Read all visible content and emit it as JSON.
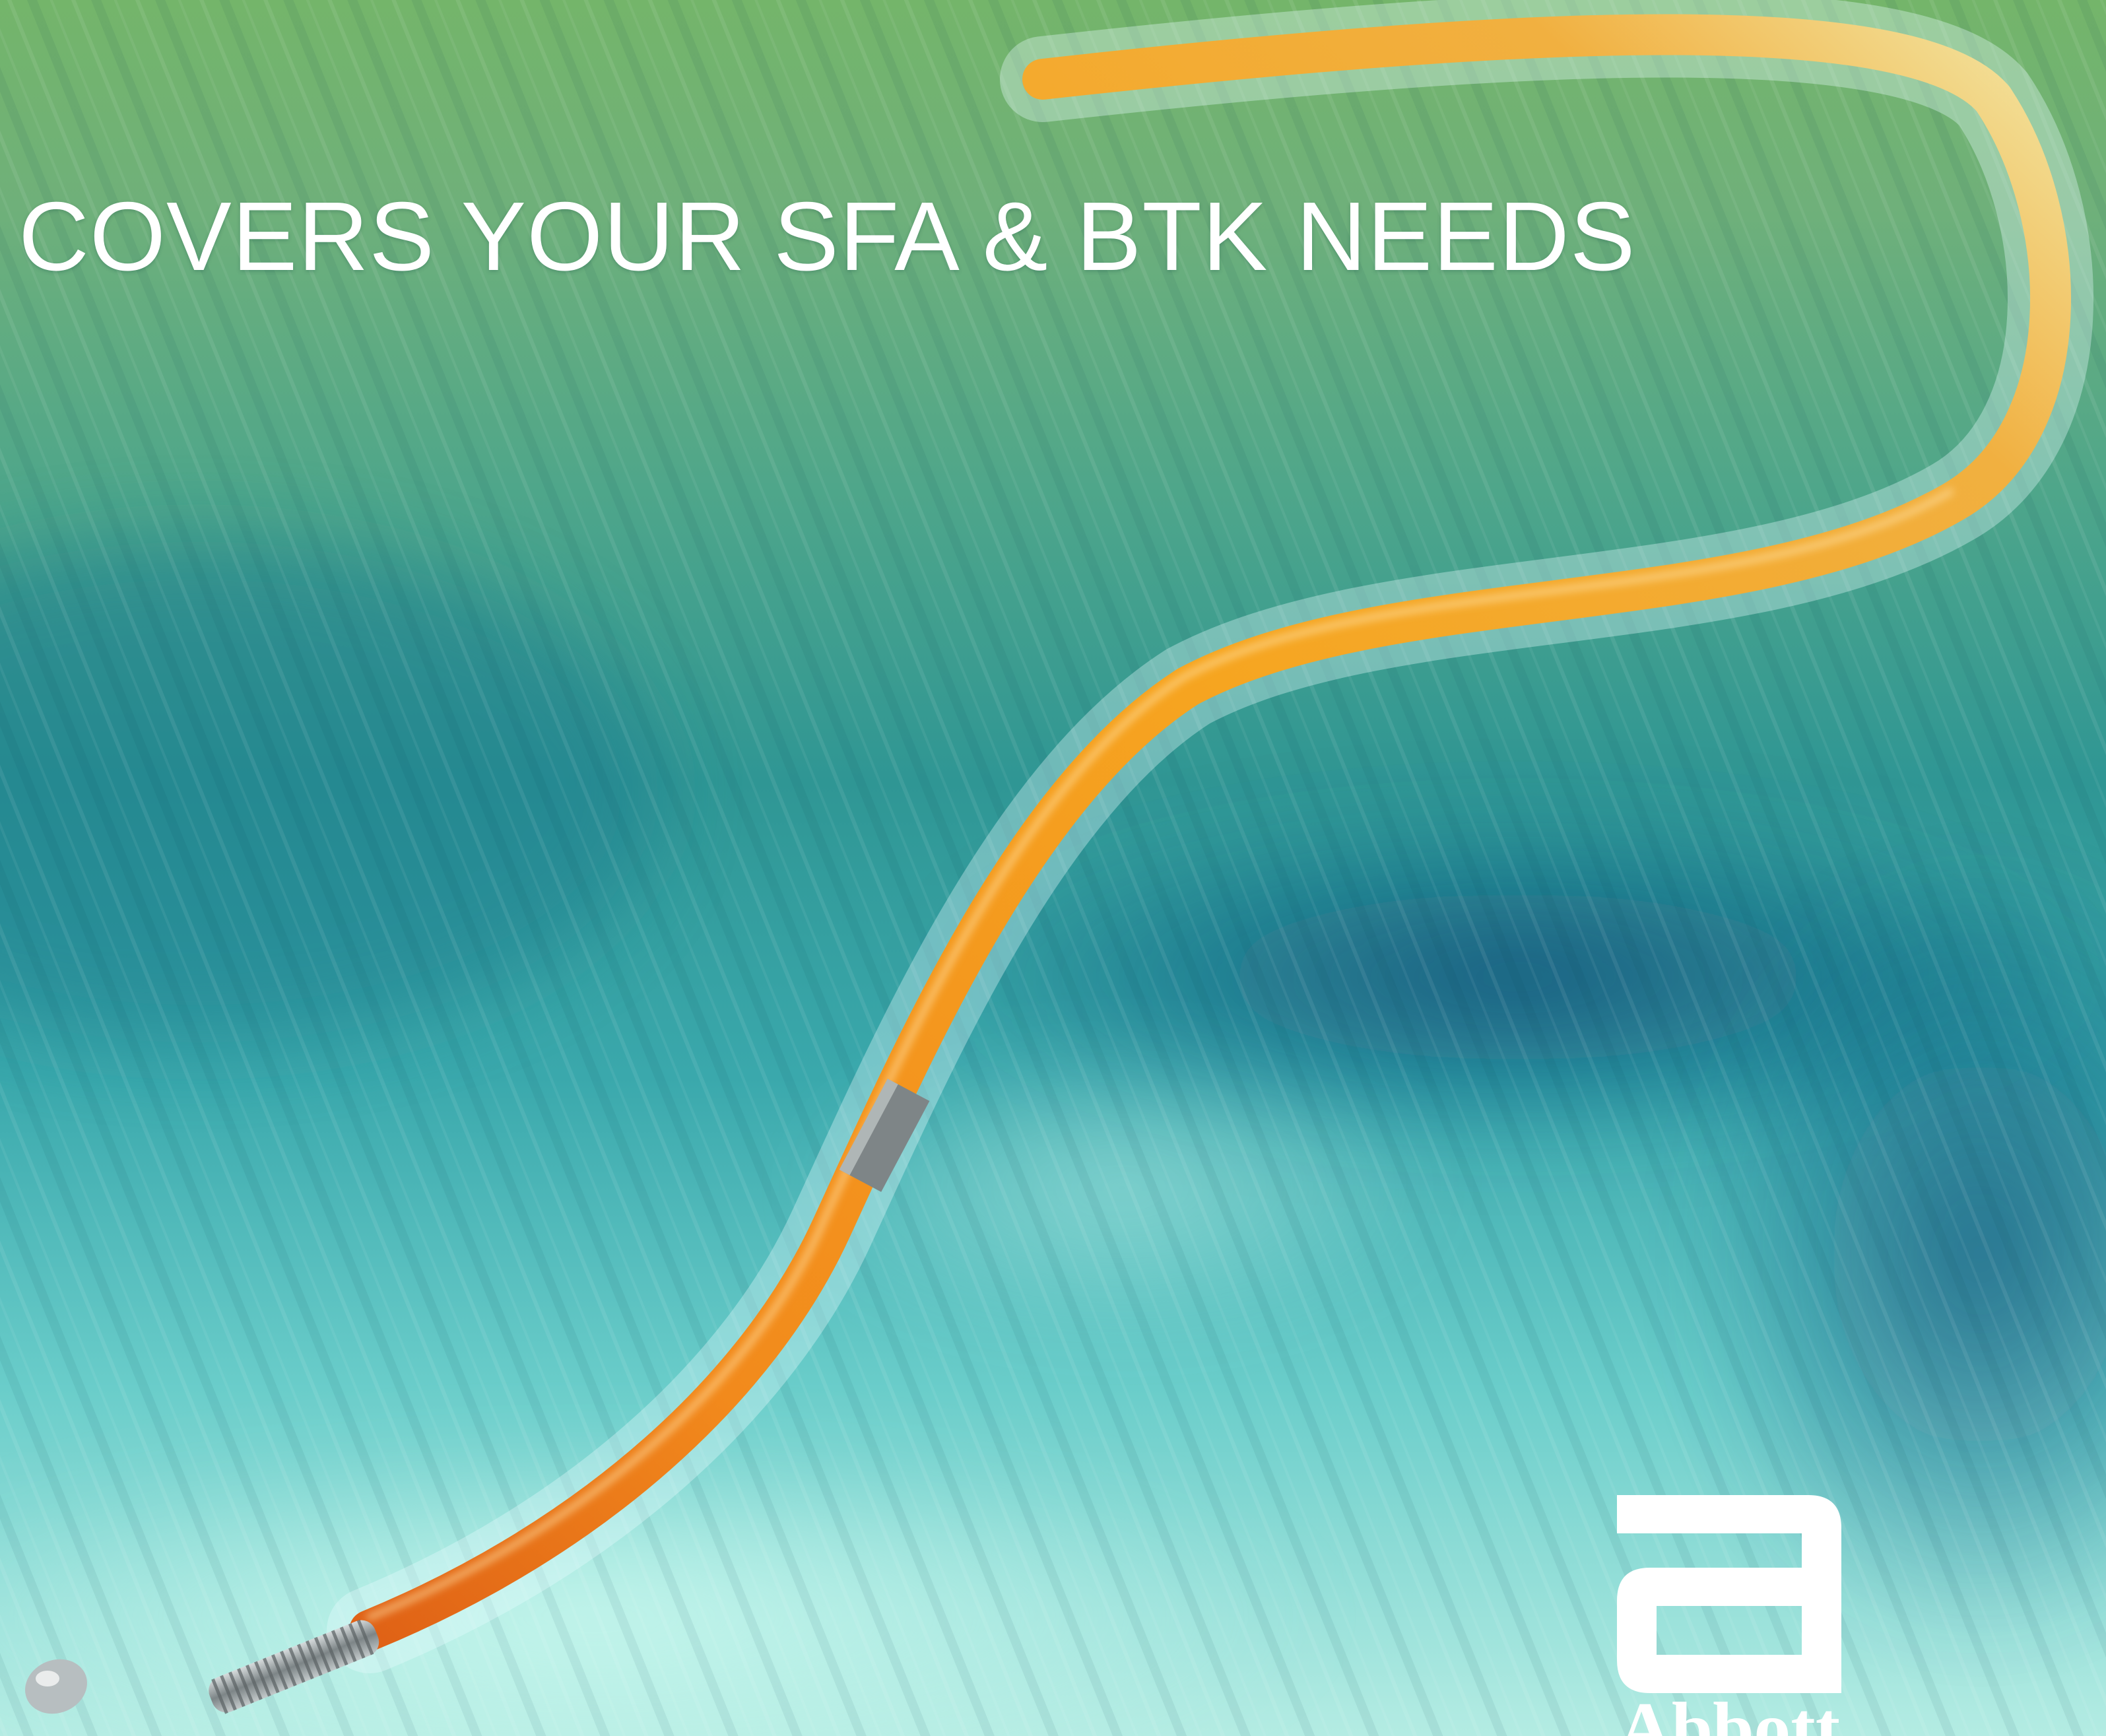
{
  "headline": "COVERS YOUR SFA & BTK NEEDS",
  "brand": {
    "name": "Abbott",
    "logo_icon": "abbott-a-logo-icon"
  },
  "colors": {
    "headline": "#ffffff",
    "logo": "#ffffff",
    "wire_core": "#f59a1c",
    "wire_tip": "#e8671a",
    "marker_band": "#8a9092",
    "coil_tip": "#9ea5a8"
  }
}
